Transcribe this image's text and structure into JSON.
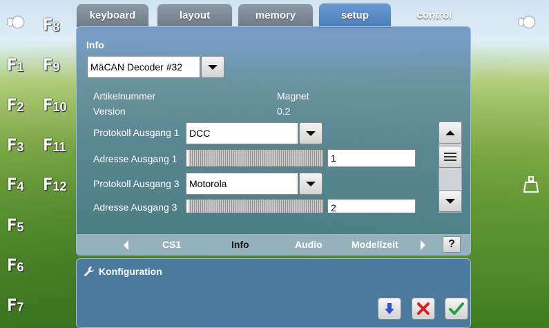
{
  "tabs": [
    {
      "label": "keyboard"
    },
    {
      "label": "layout"
    },
    {
      "label": "memory"
    },
    {
      "label": "setup"
    },
    {
      "label": "control"
    }
  ],
  "fkeys_left": [
    {
      "num": "1"
    },
    {
      "num": "2"
    },
    {
      "num": "3"
    },
    {
      "num": "4"
    },
    {
      "num": "5"
    },
    {
      "num": "6"
    },
    {
      "num": "7"
    }
  ],
  "fkeys_right": [
    {
      "num": "8"
    },
    {
      "num": "9"
    },
    {
      "num": "10"
    },
    {
      "num": "11"
    },
    {
      "num": "12"
    }
  ],
  "fkey_letter": "F",
  "info": {
    "title": "Info",
    "device_select": "MäCAN Decoder #32",
    "artikel_label": "Artikelnummer",
    "artikel_value": "Magnet",
    "version_label": "Version",
    "version_value": "0.2",
    "protokoll1_label": "Protokoll Ausgang 1",
    "protokoll1_value": "DCC",
    "adresse1_label": "Adresse Ausgang 1",
    "adresse1_value": "1",
    "protokoll3_label": "Protokoll Ausgang 3",
    "protokoll3_value": "Motorola",
    "adresse3_label": "Adresse Ausgang 3",
    "adresse3_value": "2"
  },
  "subnav": {
    "items": [
      "CS1",
      "Info",
      "Audio",
      "Modellzeit"
    ],
    "active": "Info",
    "help_label": "?"
  },
  "config": {
    "title": "Konfiguration"
  },
  "icons": {
    "left_lamp": "lamp-icon",
    "right_lamp": "lamp-icon",
    "weight": "weight-icon",
    "wrench": "wrench-icon",
    "download": "down-arrow-icon",
    "cancel": "x-icon",
    "confirm": "check-icon"
  }
}
